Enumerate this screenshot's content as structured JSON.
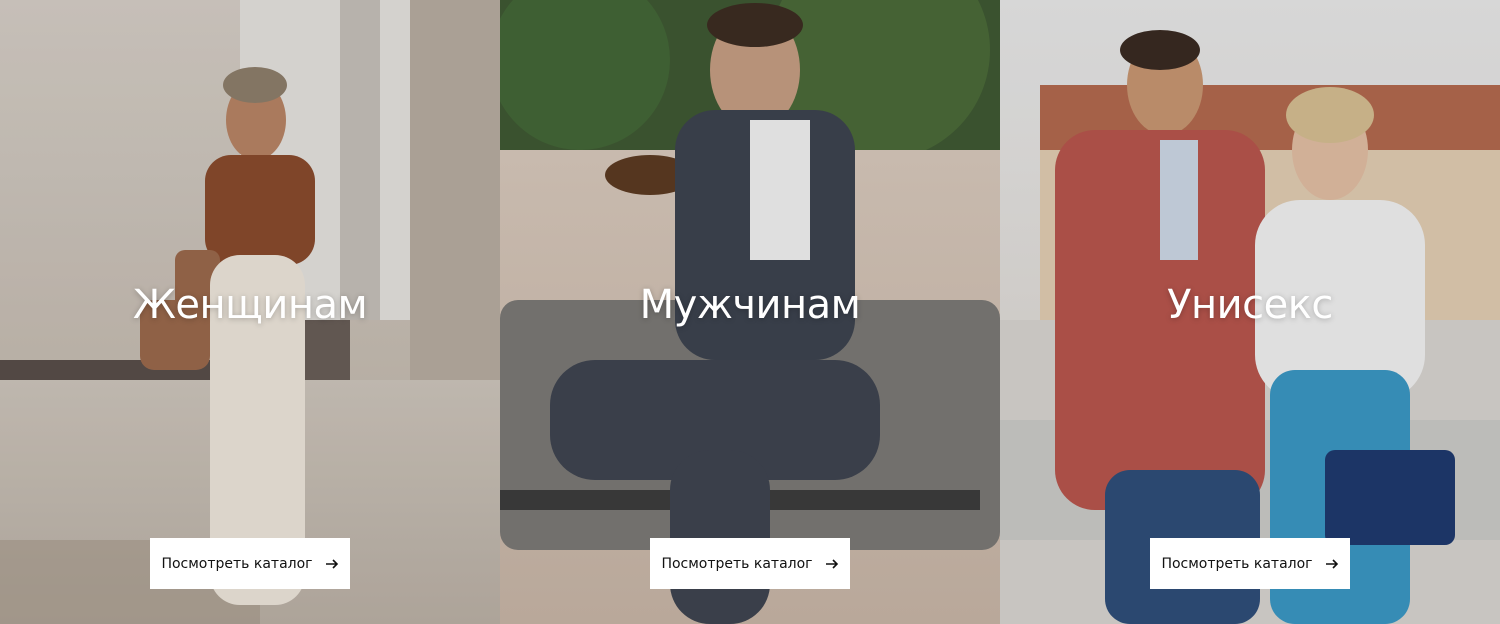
{
  "panels": [
    {
      "title": "Женщинам",
      "button_label": "Посмотреть каталог"
    },
    {
      "title": "Мужчинам",
      "button_label": "Посмотреть каталог"
    },
    {
      "title": "Унисекс",
      "button_label": "Посмотреть каталог"
    }
  ],
  "icons": {
    "button_icon": "arrow-right-icon"
  }
}
